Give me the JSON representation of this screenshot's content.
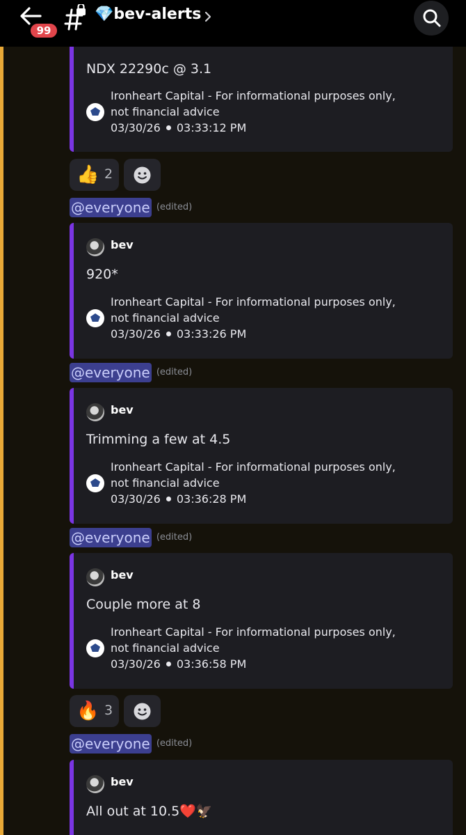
{
  "header": {
    "badge_count": "99",
    "channel_name": "💎bev-alerts",
    "icons": [
      "back-arrow-icon",
      "locked-channel-icon",
      "chevron-right-icon",
      "search-icon"
    ]
  },
  "colors": {
    "accent_embed": "#7a35e3",
    "mention_bg": "#3c3f8f",
    "badge": "#e1454b",
    "left_rail": "#e9a937"
  },
  "messages": [
    {
      "text": "NDX 22290c @ 3.1",
      "footer": "Ironheart Capital - For informational purposes only, not financial advice",
      "date": "03/30/26",
      "time": "03:33:12 PM",
      "reactions": [
        {
          "emoji": "👍",
          "count": "2"
        }
      ]
    },
    {
      "mention": "@everyone",
      "edited": "(edited)",
      "author": "bev",
      "text": "920*",
      "footer": "Ironheart Capital - For informational purposes only, not financial advice",
      "date": "03/30/26",
      "time": "03:33:26 PM"
    },
    {
      "mention": "@everyone",
      "edited": "(edited)",
      "author": "bev",
      "text": "Trimming a few at 4.5",
      "footer": "Ironheart Capital - For informational purposes only, not financial advice",
      "date": "03/30/26",
      "time": "03:36:28 PM"
    },
    {
      "mention": "@everyone",
      "edited": "(edited)",
      "author": "bev",
      "text": "Couple more at 8",
      "footer": "Ironheart Capital - For informational purposes only, not financial advice",
      "date": "03/30/26",
      "time": "03:36:58 PM",
      "reactions": [
        {
          "emoji": "🔥",
          "count": "3"
        }
      ]
    },
    {
      "mention": "@everyone",
      "edited": "(edited)",
      "author": "bev",
      "text": "All out at 10.5❤️🦅"
    }
  ]
}
